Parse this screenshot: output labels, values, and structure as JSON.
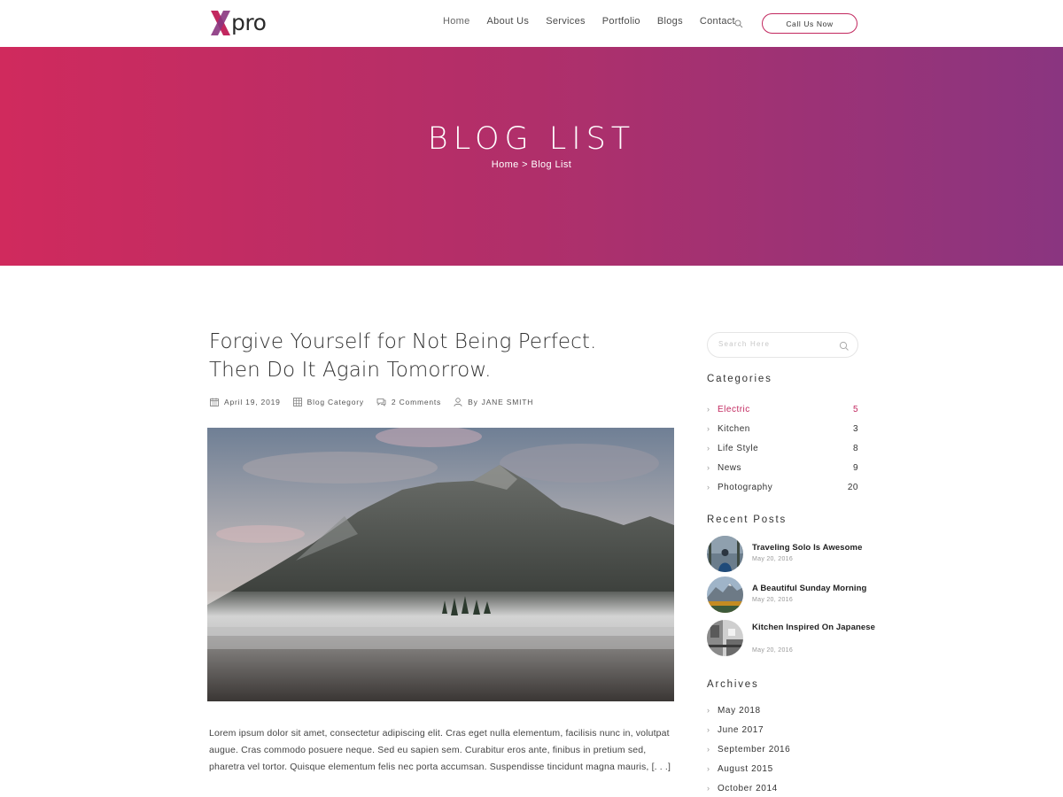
{
  "brand": {
    "logo_text": "pro",
    "accent": "#c2285f"
  },
  "nav": {
    "items": [
      "Home",
      "About Us",
      "Services",
      "Portfolio",
      "Blogs",
      "Contact"
    ],
    "cta_label": "Call Us Now"
  },
  "hero": {
    "title": "BLOG LIST",
    "breadcrumb_home": "Home",
    "breadcrumb_sep": ">",
    "breadcrumb_current": "Blog List",
    "gradient_start": "#d02a5d",
    "gradient_end": "#8a3580"
  },
  "post": {
    "title_line1": "Forgive Yourself for Not Being Perfect.",
    "title_line2": "Then Do It Again Tomorrow.",
    "date": "April 19, 2019",
    "category": "Blog Category",
    "comments": "2 Comments",
    "author_prefix": "By",
    "author": "JANE SMITH",
    "excerpt": "Lorem ipsum dolor sit amet, consectetur adipiscing elit. Cras eget nulla elementum, facilisis nunc in, volutpat augue. Cras commodo posuere neque. Sed eu sapien sem. Curabitur eros ante, finibus in pretium sed, pharetra vel tortor. Quisque elementum felis nec porta accumsan. Suspendisse tincidunt magna mauris,  [. . .]"
  },
  "sidebar": {
    "search_placeholder": "Search Here",
    "categories_title": "Categories",
    "categories": [
      {
        "name": "Electric",
        "count": "5"
      },
      {
        "name": "Kitchen",
        "count": "3"
      },
      {
        "name": "Life Style",
        "count": "8"
      },
      {
        "name": "News",
        "count": "9"
      },
      {
        "name": "Photography",
        "count": "20"
      }
    ],
    "recent_title": "Recent Posts",
    "recent": [
      {
        "title": "Traveling Solo Is Awesome",
        "date": "May 20, 2016"
      },
      {
        "title": "A Beautiful Sunday Morning",
        "date": "May 20, 2016"
      },
      {
        "title": "Kitchen Inspired On Japanese",
        "date": "May 20, 2016"
      }
    ],
    "archives_title": "Archives",
    "archives": [
      "May 2018",
      "June 2017",
      "September 2016",
      "August 2015",
      "October 2014"
    ]
  }
}
